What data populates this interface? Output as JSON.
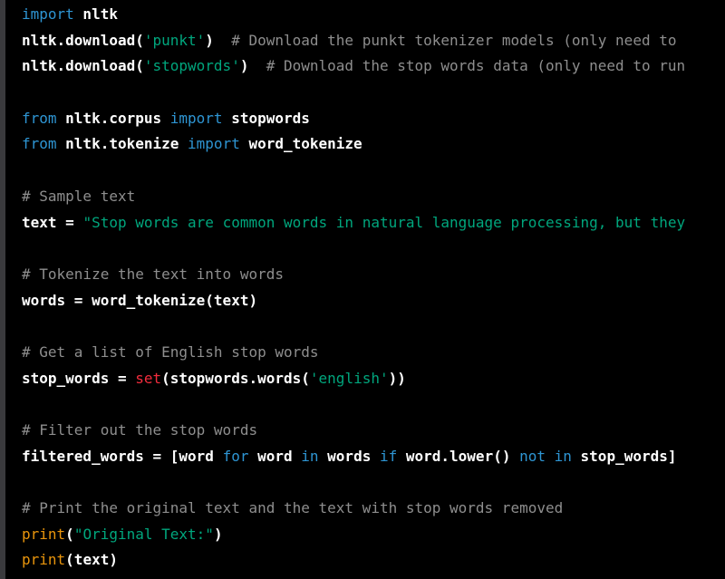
{
  "code_block": {
    "lines": [
      [
        {
          "t": "import",
          "c": "kw"
        },
        {
          "t": " nltk",
          "c": "name"
        }
      ],
      [
        {
          "t": "nltk.download(",
          "c": "name"
        },
        {
          "t": "'punkt'",
          "c": "str"
        },
        {
          "t": ")  ",
          "c": "name"
        },
        {
          "t": "# Download the punkt tokenizer models (only need to",
          "c": "com"
        }
      ],
      [
        {
          "t": "nltk.download(",
          "c": "name"
        },
        {
          "t": "'stopwords'",
          "c": "str"
        },
        {
          "t": ")  ",
          "c": "name"
        },
        {
          "t": "# Download the stop words data (only need to run",
          "c": "com"
        }
      ],
      [],
      [
        {
          "t": "from",
          "c": "kw"
        },
        {
          "t": " nltk.corpus ",
          "c": "name"
        },
        {
          "t": "import",
          "c": "kw"
        },
        {
          "t": " stopwords",
          "c": "name"
        }
      ],
      [
        {
          "t": "from",
          "c": "kw"
        },
        {
          "t": " nltk.tokenize ",
          "c": "name"
        },
        {
          "t": "import",
          "c": "kw"
        },
        {
          "t": " word_tokenize",
          "c": "name"
        }
      ],
      [],
      [
        {
          "t": "# Sample text",
          "c": "com"
        }
      ],
      [
        {
          "t": "text = ",
          "c": "name"
        },
        {
          "t": "\"Stop words are common words in natural language processing, but they",
          "c": "str"
        }
      ],
      [],
      [
        {
          "t": "# Tokenize the text into words",
          "c": "com"
        }
      ],
      [
        {
          "t": "words = word_tokenize(text)",
          "c": "name"
        }
      ],
      [],
      [
        {
          "t": "# Get a list of English stop words",
          "c": "com"
        }
      ],
      [
        {
          "t": "stop_words = ",
          "c": "name"
        },
        {
          "t": "set",
          "c": "fn"
        },
        {
          "t": "(stopwords.words(",
          "c": "name"
        },
        {
          "t": "'english'",
          "c": "str"
        },
        {
          "t": "))",
          "c": "name"
        }
      ],
      [],
      [
        {
          "t": "# Filter out the stop words",
          "c": "com"
        }
      ],
      [
        {
          "t": "filtered_words = [word ",
          "c": "name"
        },
        {
          "t": "for",
          "c": "kw"
        },
        {
          "t": " word ",
          "c": "name"
        },
        {
          "t": "in",
          "c": "kw"
        },
        {
          "t": " words ",
          "c": "name"
        },
        {
          "t": "if",
          "c": "kw"
        },
        {
          "t": " word.lower() ",
          "c": "name"
        },
        {
          "t": "not",
          "c": "kw"
        },
        {
          "t": " ",
          "c": "name"
        },
        {
          "t": "in",
          "c": "kw"
        },
        {
          "t": " stop_words]",
          "c": "name"
        }
      ],
      [],
      [
        {
          "t": "# Print the original text and the text with stop words removed",
          "c": "com"
        }
      ],
      [
        {
          "t": "print",
          "c": "bi"
        },
        {
          "t": "(",
          "c": "name"
        },
        {
          "t": "\"Original Text:\"",
          "c": "str"
        },
        {
          "t": ")",
          "c": "name"
        }
      ],
      [
        {
          "t": "print",
          "c": "bi"
        },
        {
          "t": "(text)",
          "c": "name"
        }
      ]
    ]
  },
  "colors": {
    "panel_background": "#000000",
    "frame_background": "#3a3a3d",
    "keyword": "#2e95d3",
    "string": "#00a67d",
    "comment": "#8e8e8e",
    "builtin_print": "#e9950c",
    "builtin_set": "#f22c3d",
    "identifier": "#ffffff"
  }
}
